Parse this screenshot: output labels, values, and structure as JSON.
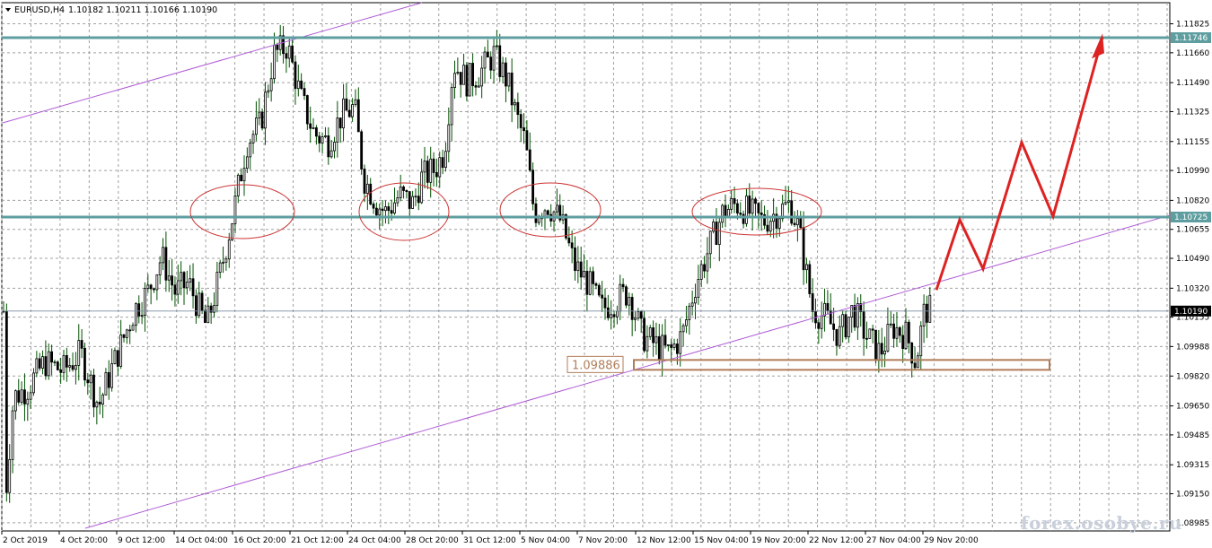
{
  "header": {
    "symbol": "EURUSD,H4",
    "ohlc": "1.10182 1.10211 1.10166 1.10190"
  },
  "watermark": "forex.osobye.ru",
  "chart_data": {
    "type": "candlestick",
    "symbol": "EURUSD",
    "timeframe": "H4",
    "y_ticks": [
      "1.11825",
      "1.11660",
      "1.11490",
      "1.11325",
      "1.11155",
      "1.10990",
      "1.10820",
      "1.10655",
      "1.10490",
      "1.10320",
      "1.10155",
      "1.09988",
      "1.09820",
      "1.09650",
      "1.09485",
      "1.09315",
      "1.09150",
      "1.08985"
    ],
    "ylim": [
      1.0888,
      1.1195
    ],
    "x_labels": [
      "2 Oct 2019",
      "4 Oct 20:00",
      "9 Oct 12:00",
      "14 Oct 04:00",
      "16 Oct 20:00",
      "21 Oct 12:00",
      "24 Oct 04:00",
      "28 Oct 20:00",
      "31 Oct 12:00",
      "5 Nov 04:00",
      "7 Nov 20:00",
      "12 Nov 12:00",
      "15 Nov 04:00",
      "19 Nov 20:00",
      "22 Nov 12:00",
      "27 Nov 04:00",
      "29 Nov 20:00"
    ],
    "levels": [
      {
        "label": "1.11746",
        "value": 1.11746
      },
      {
        "label": "1.10725",
        "value": 1.10725
      }
    ],
    "current_price": {
      "label": "1.10190",
      "value": 1.1019
    },
    "support_box": {
      "label": "1.09886",
      "value": 1.09886
    },
    "forecast_path": [
      1.1031,
      1.1071,
      1.1043,
      1.1115,
      1.1073,
      1.1175
    ],
    "colors": {
      "level_line": "#5f9ea0",
      "channel": "#b05cd6",
      "ellipse": "#cc3333",
      "forecast": "#dd2222",
      "support_box": "#b07d5a",
      "candle": "#005000",
      "grid": "#a0a0a0"
    }
  }
}
